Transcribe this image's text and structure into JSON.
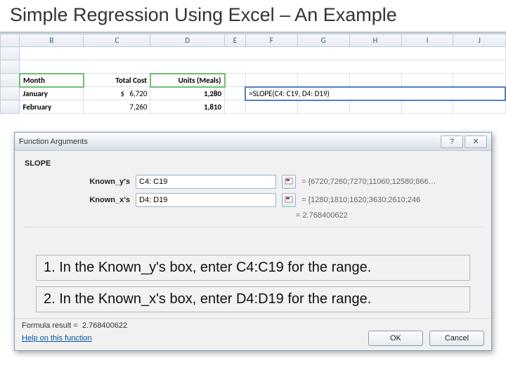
{
  "slide": {
    "title": "Simple Regression Using Excel – An Example"
  },
  "sheet": {
    "columns": [
      "",
      "B",
      "C",
      "D",
      "E",
      "F",
      "G",
      "H",
      "I",
      "J"
    ],
    "headers": {
      "month": "Month",
      "total_cost": "Total Cost",
      "units": "Units (Meals)"
    },
    "rows": [
      {
        "month": "January",
        "currency": "$",
        "cost": "6,720",
        "units": "1,280"
      },
      {
        "month": "February",
        "currency": "",
        "cost": "7,260",
        "units": "1,810"
      }
    ],
    "formula": "=SLOPE(C4: C19, D4: D19)"
  },
  "dialog": {
    "title": "Function Arguments",
    "function": "SLOPE",
    "args": {
      "y": {
        "label": "Known_y's",
        "value": "C4: C19",
        "eval": "=  {6720;7260;7270;11060;12580;866…"
      },
      "x": {
        "label": "Known_x's",
        "value": "D4: D19",
        "eval": "=  {1280;1810;1620;3630;2610;246"
      }
    },
    "result_value": "=  2.768400622",
    "formula_result_label": "Formula result =",
    "formula_result_value": "2.768400622",
    "help_link": "Help on this function",
    "ok": "OK",
    "cancel": "Cancel"
  },
  "instructions": {
    "step1": "1. In the Known_y's box, enter C4:C19 for the range.",
    "step2": "2. In the Known_x's box, enter D4:D19 for the range."
  }
}
